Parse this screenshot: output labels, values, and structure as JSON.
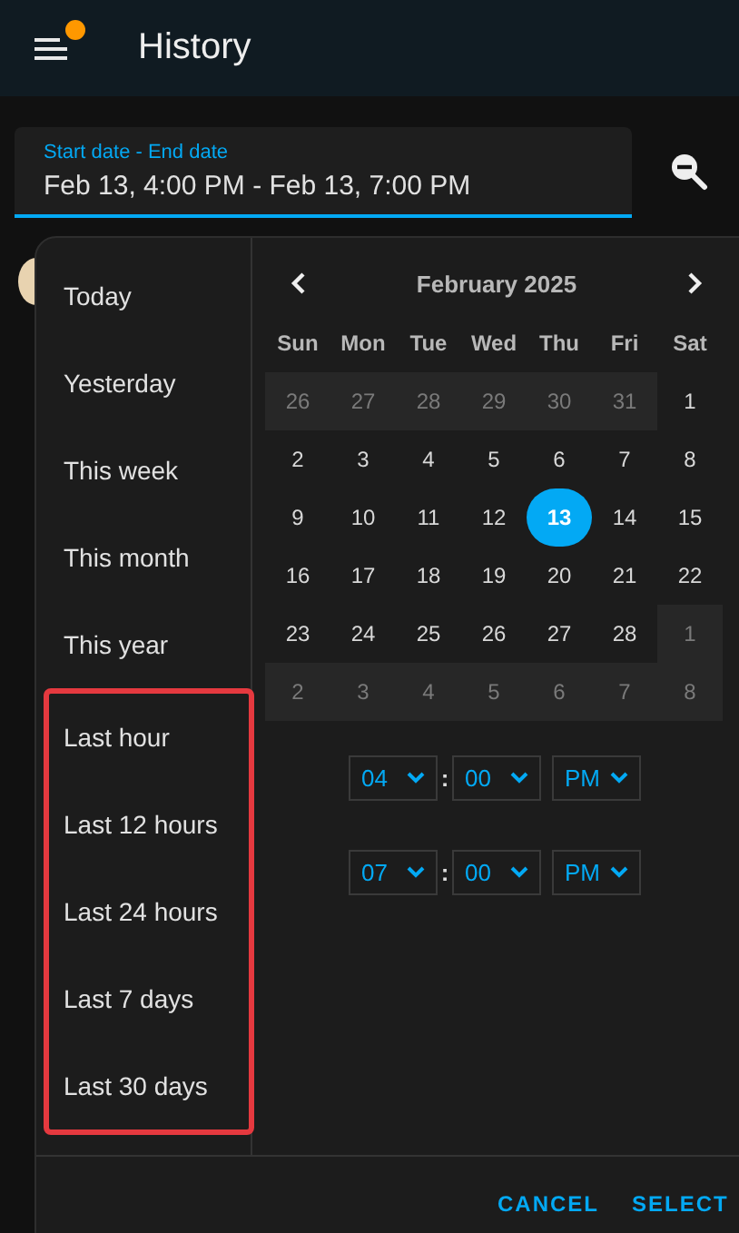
{
  "header": {
    "title": "History",
    "notification": true
  },
  "date_field": {
    "label": "Start date - End date",
    "value": "Feb 13, 4:00 PM - Feb 13, 7:00 PM"
  },
  "ranges": [
    {
      "label": "Today"
    },
    {
      "label": "Yesterday"
    },
    {
      "label": "This week"
    },
    {
      "label": "This month"
    },
    {
      "label": "This year"
    }
  ],
  "highlighted_ranges": [
    {
      "label": "Last hour"
    },
    {
      "label": "Last 12 hours"
    },
    {
      "label": "Last 24 hours"
    },
    {
      "label": "Last 7 days"
    },
    {
      "label": "Last 30 days"
    }
  ],
  "calendar": {
    "month": "February 2025",
    "weekdays": [
      "Sun",
      "Mon",
      "Tue",
      "Wed",
      "Thu",
      "Fri",
      "Sat"
    ],
    "days": [
      {
        "day": "26",
        "outside": true,
        "selected": false
      },
      {
        "day": "27",
        "outside": true,
        "selected": false
      },
      {
        "day": "28",
        "outside": true,
        "selected": false
      },
      {
        "day": "29",
        "outside": true,
        "selected": false
      },
      {
        "day": "30",
        "outside": true,
        "selected": false
      },
      {
        "day": "31",
        "outside": true,
        "selected": false
      },
      {
        "day": "1",
        "outside": false,
        "selected": false
      },
      {
        "day": "2",
        "outside": false,
        "selected": false
      },
      {
        "day": "3",
        "outside": false,
        "selected": false
      },
      {
        "day": "4",
        "outside": false,
        "selected": false
      },
      {
        "day": "5",
        "outside": false,
        "selected": false
      },
      {
        "day": "6",
        "outside": false,
        "selected": false
      },
      {
        "day": "7",
        "outside": false,
        "selected": false
      },
      {
        "day": "8",
        "outside": false,
        "selected": false
      },
      {
        "day": "9",
        "outside": false,
        "selected": false
      },
      {
        "day": "10",
        "outside": false,
        "selected": false
      },
      {
        "day": "11",
        "outside": false,
        "selected": false
      },
      {
        "day": "12",
        "outside": false,
        "selected": false
      },
      {
        "day": "13",
        "outside": false,
        "selected": true
      },
      {
        "day": "14",
        "outside": false,
        "selected": false
      },
      {
        "day": "15",
        "outside": false,
        "selected": false
      },
      {
        "day": "16",
        "outside": false,
        "selected": false
      },
      {
        "day": "17",
        "outside": false,
        "selected": false
      },
      {
        "day": "18",
        "outside": false,
        "selected": false
      },
      {
        "day": "19",
        "outside": false,
        "selected": false
      },
      {
        "day": "20",
        "outside": false,
        "selected": false
      },
      {
        "day": "21",
        "outside": false,
        "selected": false
      },
      {
        "day": "22",
        "outside": false,
        "selected": false
      },
      {
        "day": "23",
        "outside": false,
        "selected": false
      },
      {
        "day": "24",
        "outside": false,
        "selected": false
      },
      {
        "day": "25",
        "outside": false,
        "selected": false
      },
      {
        "day": "26",
        "outside": false,
        "selected": false
      },
      {
        "day": "27",
        "outside": false,
        "selected": false
      },
      {
        "day": "28",
        "outside": false,
        "selected": false
      },
      {
        "day": "1",
        "outside": true,
        "selected": false
      },
      {
        "day": "2",
        "outside": true,
        "selected": false
      },
      {
        "day": "3",
        "outside": true,
        "selected": false
      },
      {
        "day": "4",
        "outside": true,
        "selected": false
      },
      {
        "day": "5",
        "outside": true,
        "selected": false
      },
      {
        "day": "6",
        "outside": true,
        "selected": false
      },
      {
        "day": "7",
        "outside": true,
        "selected": false
      },
      {
        "day": "8",
        "outside": true,
        "selected": false
      }
    ]
  },
  "times": [
    {
      "hour": "04",
      "separator": ":",
      "minute": "00",
      "period": "PM"
    },
    {
      "hour": "07",
      "separator": ":",
      "minute": "00",
      "period": "PM"
    }
  ],
  "buttons": [
    "CANCEL",
    "SELECT"
  ]
}
